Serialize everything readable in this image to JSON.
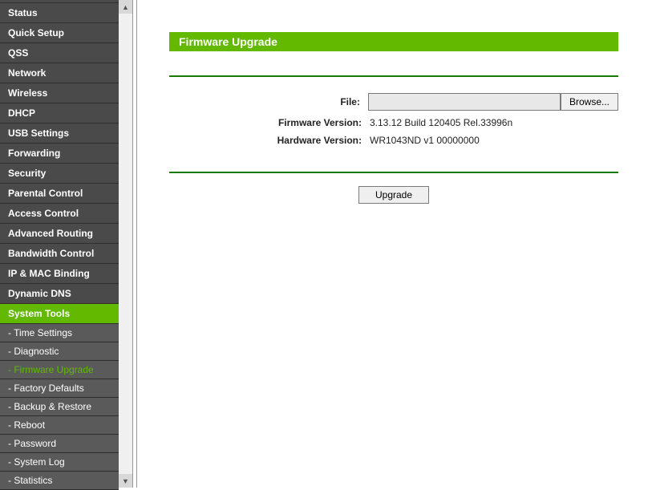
{
  "sidebar": {
    "items": [
      {
        "label": "Status"
      },
      {
        "label": "Quick Setup"
      },
      {
        "label": "QSS"
      },
      {
        "label": "Network"
      },
      {
        "label": "Wireless"
      },
      {
        "label": "DHCP"
      },
      {
        "label": "USB Settings"
      },
      {
        "label": "Forwarding"
      },
      {
        "label": "Security"
      },
      {
        "label": "Parental Control"
      },
      {
        "label": "Access Control"
      },
      {
        "label": "Advanced Routing"
      },
      {
        "label": "Bandwidth Control"
      },
      {
        "label": "IP & MAC Binding"
      },
      {
        "label": "Dynamic DNS"
      },
      {
        "label": "System Tools"
      }
    ],
    "subitems": [
      {
        "label": "- Time Settings"
      },
      {
        "label": "- Diagnostic"
      },
      {
        "label": "- Firmware Upgrade"
      },
      {
        "label": "- Factory Defaults"
      },
      {
        "label": "- Backup & Restore"
      },
      {
        "label": "- Reboot"
      },
      {
        "label": "- Password"
      },
      {
        "label": "- System Log"
      },
      {
        "label": "- Statistics"
      }
    ]
  },
  "content": {
    "title": "Firmware Upgrade",
    "file_label": "File:",
    "browse_label": "Browse...",
    "firmware_version_label": "Firmware Version:",
    "firmware_version_value": "3.13.12 Build 120405 Rel.33996n",
    "hardware_version_label": "Hardware Version:",
    "hardware_version_value": "WR1043ND v1 00000000",
    "upgrade_label": "Upgrade"
  }
}
